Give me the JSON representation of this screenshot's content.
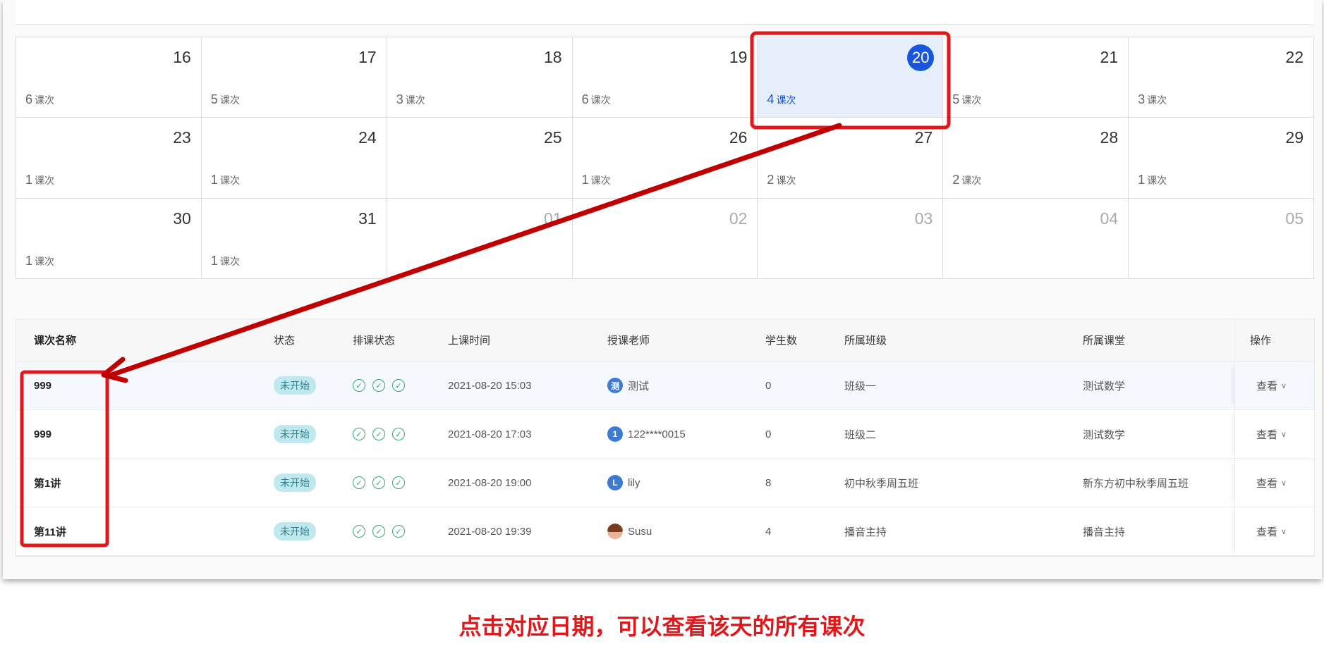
{
  "calendar": {
    "rows": [
      [
        {
          "day": "16",
          "count": "6",
          "unit": "课次"
        },
        {
          "day": "17",
          "count": "5",
          "unit": "课次"
        },
        {
          "day": "18",
          "count": "3",
          "unit": "课次"
        },
        {
          "day": "19",
          "count": "6",
          "unit": "课次"
        },
        {
          "day": "20",
          "count": "4",
          "unit": "课次",
          "selected": true
        },
        {
          "day": "21",
          "count": "5",
          "unit": "课次"
        },
        {
          "day": "22",
          "count": "3",
          "unit": "课次"
        }
      ],
      [
        {
          "day": "23",
          "count": "1",
          "unit": "课次"
        },
        {
          "day": "24",
          "count": "1",
          "unit": "课次"
        },
        {
          "day": "25",
          "count": "",
          "unit": ""
        },
        {
          "day": "26",
          "count": "1",
          "unit": "课次"
        },
        {
          "day": "27",
          "count": "2",
          "unit": "课次"
        },
        {
          "day": "28",
          "count": "2",
          "unit": "课次"
        },
        {
          "day": "29",
          "count": "1",
          "unit": "课次"
        }
      ],
      [
        {
          "day": "30",
          "count": "1",
          "unit": "课次"
        },
        {
          "day": "31",
          "count": "1",
          "unit": "课次"
        },
        {
          "day": "01",
          "count": "",
          "unit": "",
          "other": true
        },
        {
          "day": "02",
          "count": "",
          "unit": "",
          "other": true
        },
        {
          "day": "03",
          "count": "",
          "unit": "",
          "other": true
        },
        {
          "day": "04",
          "count": "",
          "unit": "",
          "other": true
        },
        {
          "day": "05",
          "count": "",
          "unit": "",
          "other": true
        }
      ]
    ],
    "selected_color": "#1a56db"
  },
  "table": {
    "headers": {
      "name": "课次名称",
      "state": "状态",
      "schedule": "排课状态",
      "time": "上课时间",
      "teacher": "授课老师",
      "students": "学生数",
      "class": "所属班级",
      "room": "所属课堂",
      "op": "操作"
    },
    "rows": [
      {
        "name": "999",
        "state": "未开始",
        "time": "2021-08-20 15:03",
        "avatar": "测",
        "teacher": "测试",
        "students": "0",
        "class": "班级一",
        "room": "测试数学",
        "op": "查看"
      },
      {
        "name": "999",
        "state": "未开始",
        "time": "2021-08-20 17:03",
        "avatar": "1",
        "teacher": "122****0015",
        "students": "0",
        "class": "班级二",
        "room": "测试数学",
        "op": "查看"
      },
      {
        "name": "第1讲",
        "state": "未开始",
        "time": "2021-08-20 19:00",
        "avatar": "L",
        "teacher": "lily",
        "students": "8",
        "class": "初中秋季周五班",
        "room": "新东方初中秋季周五班",
        "op": "查看"
      },
      {
        "name": "第11讲",
        "state": "未开始",
        "time": "2021-08-20 19:39",
        "avatar": "",
        "teacher": "Susu",
        "students": "4",
        "class": "播音主持",
        "room": "播音主持",
        "op": "查看"
      }
    ]
  },
  "caption": "点击对应日期，可以查看该天的所有课次",
  "colors": {
    "annotation_red": "#e0181c",
    "arrow_red": "#c00000",
    "badge_bg": "#bfe9ef",
    "check_green": "#39a86a"
  }
}
